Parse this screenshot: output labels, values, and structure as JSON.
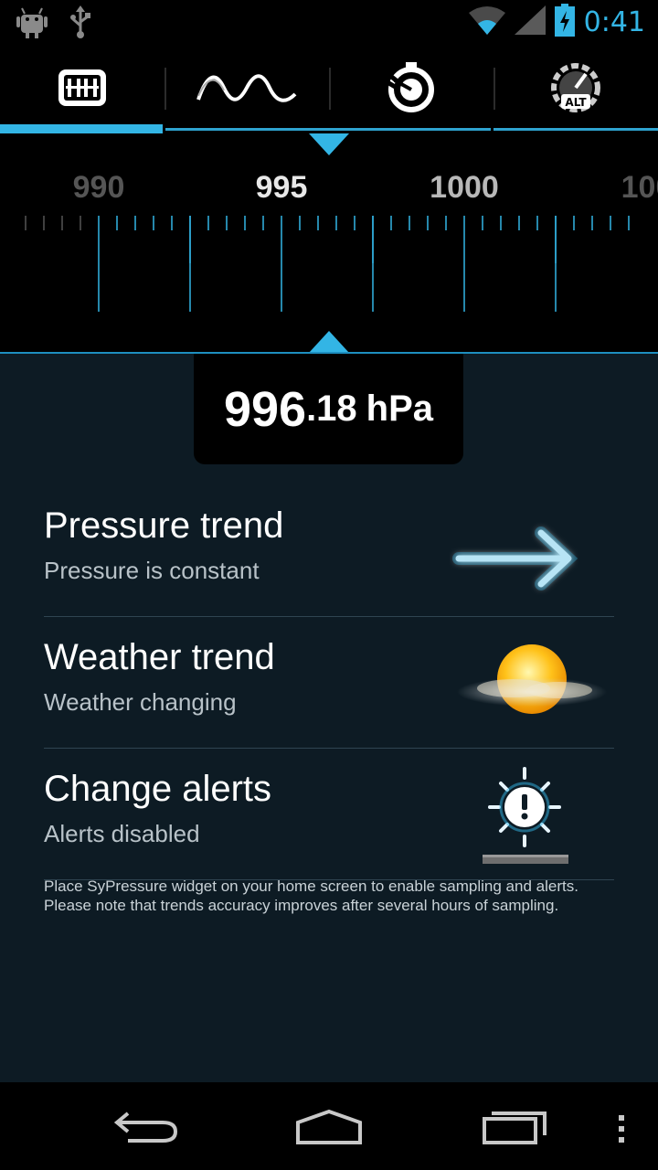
{
  "status_bar": {
    "time": "0:41",
    "icons": [
      "android-debug-icon",
      "usb-icon",
      "wifi-icon",
      "signal-icon",
      "battery-charging-icon"
    ]
  },
  "tabs": [
    {
      "icon": "barometer-gauge-icon",
      "active": true
    },
    {
      "icon": "wave-graph-icon",
      "active": false
    },
    {
      "icon": "stopwatch-icon",
      "active": false
    },
    {
      "icon": "altitude-gauge-icon",
      "active": false
    }
  ],
  "ruler": {
    "labels": [
      "990",
      "995",
      "1000",
      "100"
    ],
    "accent_color": "#33b5e5"
  },
  "reading": {
    "integer": "996",
    "decimal": ".18",
    "unit": "hPa"
  },
  "items": [
    {
      "title": "Pressure trend",
      "subtitle": "Pressure is constant",
      "icon": "arrow-right-icon"
    },
    {
      "title": "Weather trend",
      "subtitle": "Weather changing",
      "icon": "sun-cloud-icon"
    },
    {
      "title": "Change alerts",
      "subtitle": "Alerts disabled",
      "icon": "alert-sun-icon"
    }
  ],
  "note": "Place SyPressure widget on your home screen to enable sampling and alerts. Please note that trends accuracy improves after several hours of sampling.",
  "navbar": {
    "buttons": [
      "back-icon",
      "home-icon",
      "recent-apps-icon",
      "overflow-menu-icon"
    ]
  }
}
